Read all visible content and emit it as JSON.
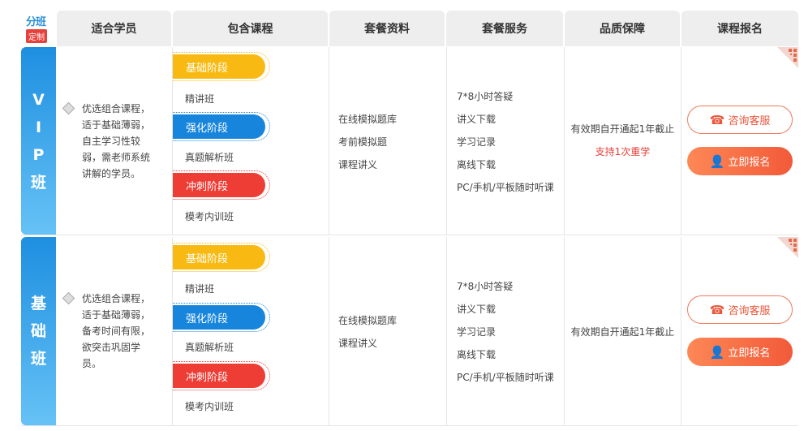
{
  "header": {
    "logo_top": "分班",
    "logo_bottom": "定制",
    "columns": [
      "适合学员",
      "包含课程",
      "套餐资料",
      "套餐服务",
      "品质保障",
      "课程报名"
    ]
  },
  "rows": [
    {
      "label": [
        "V",
        "I",
        "P",
        "班"
      ],
      "desc": [
        "优选组合课程，",
        "适于基础薄弱，",
        "自主学习性较",
        "弱，需老师系统",
        "讲解的学员。"
      ],
      "stages": [
        "基础阶段",
        "强化阶段",
        "冲刺阶段"
      ],
      "courses": [
        "精讲班",
        "真题解析班",
        "模考内训班"
      ],
      "materials": [
        "在线模拟题库",
        "考前模拟题",
        "课程讲义"
      ],
      "services": [
        "7*8小时答疑",
        "讲义下载",
        "学习记录",
        "离线下载",
        "PC/手机/平板随时听课"
      ],
      "guarantee": "有效期自开通起1年截止",
      "guarantee_extra": "支持1次重学",
      "consult_label": "咨询客服",
      "enroll_label": "立即报名"
    },
    {
      "label": [
        "基",
        "础",
        "班"
      ],
      "desc": [
        "优选组合课程，",
        "适于基础薄弱，",
        "备考时间有限，",
        "欲突击巩固学",
        "员。"
      ],
      "stages": [
        "基础阶段",
        "强化阶段",
        "冲刺阶段"
      ],
      "courses": [
        "精讲班",
        "真题解析班",
        "模考内训班"
      ],
      "materials": [
        "在线模拟题库",
        "课程讲义"
      ],
      "services": [
        "7*8小时答疑",
        "讲义下载",
        "学习记录",
        "离线下载",
        "PC/手机/平板随时听课"
      ],
      "guarantee": "有效期自开通起1年截止",
      "consult_label": "咨询客服",
      "enroll_label": "立即报名"
    }
  ]
}
